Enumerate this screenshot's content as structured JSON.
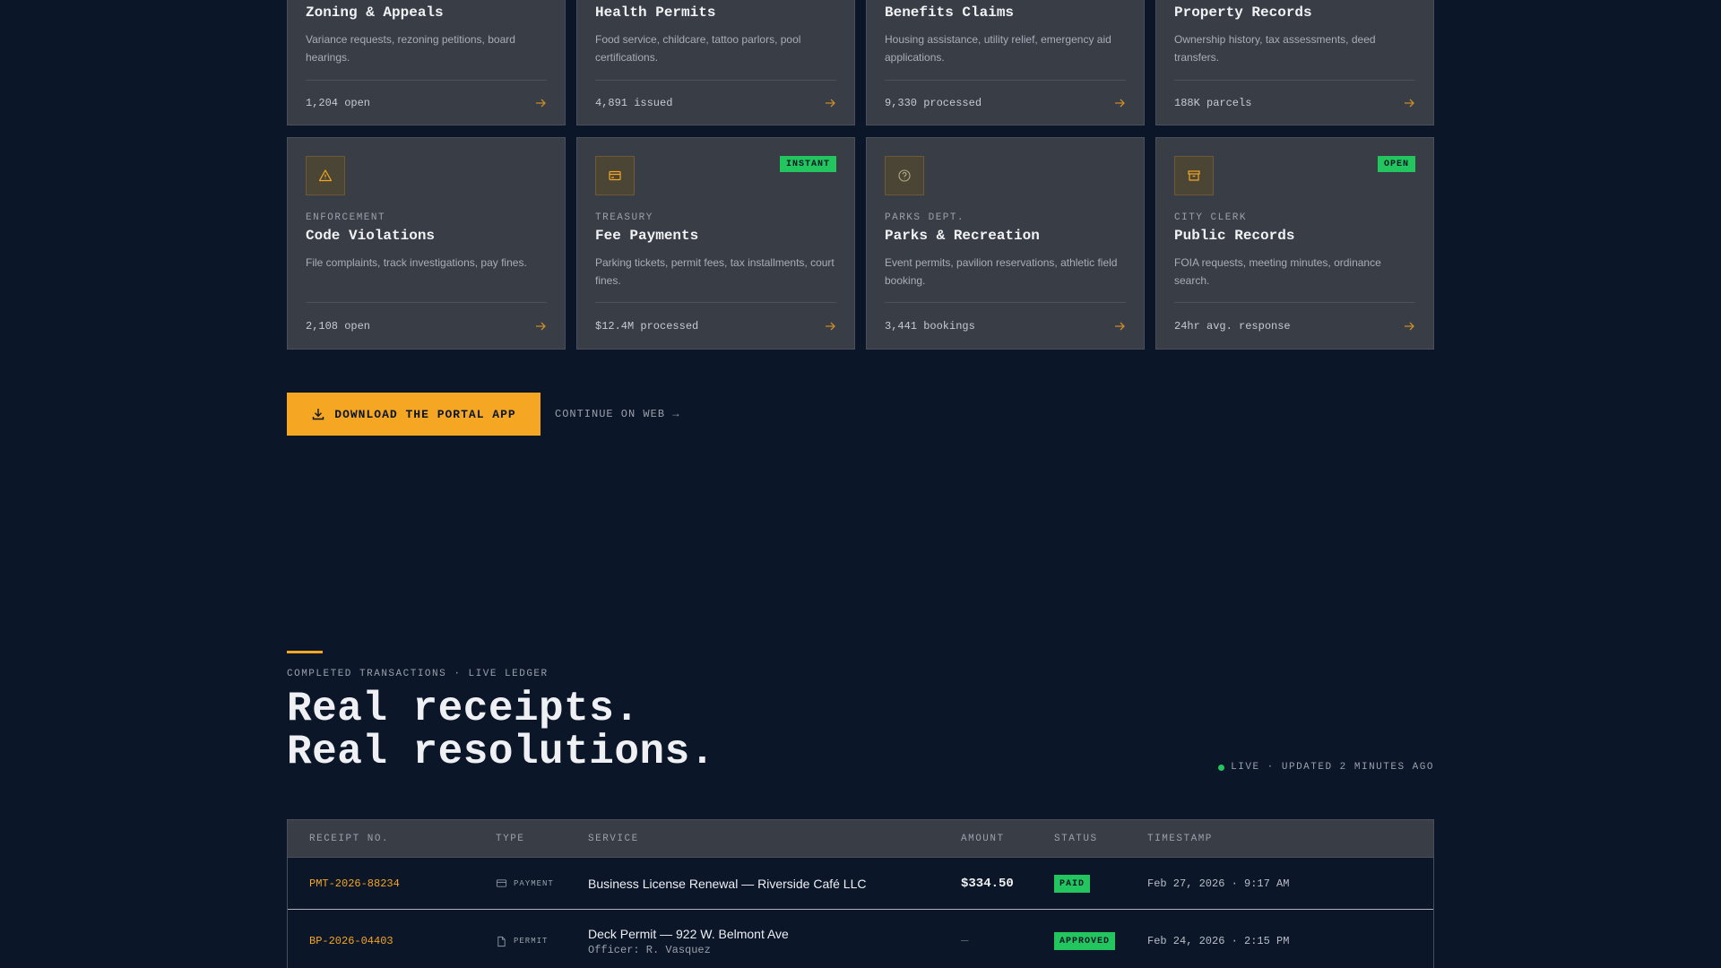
{
  "cards_row1": [
    {
      "title": "Zoning & Appeals",
      "desc": "Variance requests, rezoning petitions, board hearings.",
      "stat": "1,204 open"
    },
    {
      "title": "Health Permits",
      "desc": "Food service, childcare, tattoo parlors, pool certifications.",
      "stat": "4,891 issued"
    },
    {
      "title": "Benefits Claims",
      "desc": "Housing assistance, utility relief, emergency aid applications.",
      "stat": "9,330 processed"
    },
    {
      "title": "Property Records",
      "desc": "Ownership history, tax assessments, deed transfers.",
      "stat": "188K parcels"
    }
  ],
  "cards_row2": [
    {
      "icon": "warning-icon",
      "eyebrow": "ENFORCEMENT",
      "title": "Code Violations",
      "desc": "File complaints, track investigations, pay fines.",
      "stat": "2,108 open",
      "badge": ""
    },
    {
      "icon": "credit-card-icon",
      "eyebrow": "TREASURY",
      "title": "Fee Payments",
      "desc": "Parking tickets, permit fees, tax installments, court fines.",
      "stat": "$12.4M processed",
      "badge": "INSTANT"
    },
    {
      "icon": "help-circle-icon",
      "eyebrow": "PARKS DEPT.",
      "title": "Parks & Recreation",
      "desc": "Event permits, pavilion reservations, athletic field booking.",
      "stat": "3,441 bookings",
      "badge": ""
    },
    {
      "icon": "archive-icon",
      "eyebrow": "CITY CLERK",
      "title": "Public Records",
      "desc": "FOIA requests, meeting minutes, ordinance search.",
      "stat": "24hr avg. response",
      "badge": "OPEN"
    }
  ],
  "cta": {
    "download_label": "DOWNLOAD THE PORTAL APP",
    "web_label": "CONTINUE ON WEB →"
  },
  "ledger": {
    "eyebrow": "COMPLETED TRANSACTIONS · LIVE LEDGER",
    "title_line1": "Real receipts.",
    "title_line2": "Real resolutions.",
    "live_label": "LIVE · UPDATED 2 MINUTES AGO",
    "columns": [
      "RECEIPT NO.",
      "TYPE",
      "SERVICE",
      "AMOUNT",
      "STATUS",
      "TIMESTAMP"
    ],
    "rows": [
      {
        "receipt": "PMT-2026-88234",
        "type": "PAYMENT",
        "type_icon": "credit-card-icon",
        "service": "Business License Renewal — Riverside Café LLC",
        "sub": "",
        "amount": "$334.50",
        "status": "PAID",
        "timestamp": "Feb 27, 2026 · 9:17 AM"
      },
      {
        "receipt": "BP-2026-04403",
        "type": "PERMIT",
        "type_icon": "document-icon",
        "service": "Deck Permit — 922 W. Belmont Ave",
        "sub": "Officer: R. Vasquez",
        "amount": "—",
        "status": "APPROVED",
        "timestamp": "Feb 24, 2026 · 2:15 PM"
      }
    ]
  },
  "colors": {
    "background": "#0b1628",
    "card": "#393d46",
    "accent": "#f5a623",
    "success": "#22c55e"
  }
}
